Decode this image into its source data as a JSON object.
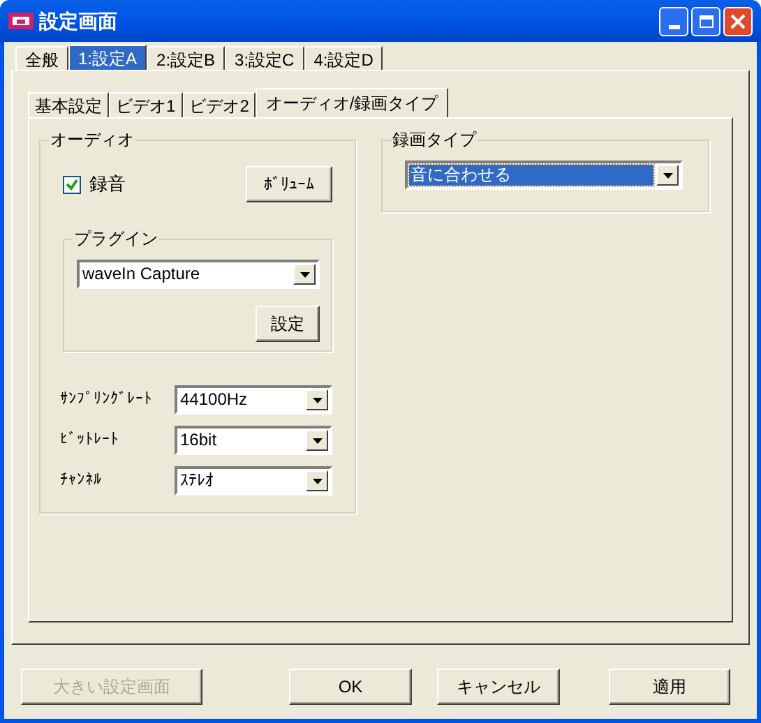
{
  "window": {
    "title": "設定画面"
  },
  "tabs": [
    {
      "label": "全般",
      "selected": false
    },
    {
      "label": "1:設定A",
      "selected": true
    },
    {
      "label": "2:設定B",
      "selected": false
    },
    {
      "label": "3:設定C",
      "selected": false
    },
    {
      "label": "4:設定D",
      "selected": false
    }
  ],
  "subtabs": [
    {
      "label": "基本設定",
      "selected": false
    },
    {
      "label": "ビデオ1",
      "selected": false
    },
    {
      "label": "ビデオ2",
      "selected": false
    },
    {
      "label": "オーディオ/録画タイプ",
      "selected": true
    }
  ],
  "audio": {
    "title": "オーディオ",
    "record": {
      "label": "録音",
      "checked": true
    },
    "volume_button": "ﾎﾞﾘｭｰﾑ",
    "plugin": {
      "title": "プラグイン",
      "value": "waveIn Capture",
      "settings_button": "設定"
    },
    "fields": [
      {
        "label": "ｻﾝﾌﾟﾘﾝｸﾞﾚｰﾄ",
        "value": "44100Hz"
      },
      {
        "label": "ﾋﾞｯﾄﾚｰﾄ",
        "value": "16bit"
      },
      {
        "label": "ﾁｬﾝﾈﾙ",
        "value": "ｽﾃﾚｵ"
      }
    ]
  },
  "recording_type": {
    "title": "録画タイプ",
    "value": "音に合わせる",
    "focused": true
  },
  "buttons": [
    {
      "label": "大きい設定画面",
      "disabled": true
    },
    {
      "label": "OK",
      "disabled": false
    },
    {
      "label": "キャンセル",
      "disabled": false
    },
    {
      "label": "適用",
      "disabled": false
    }
  ]
}
